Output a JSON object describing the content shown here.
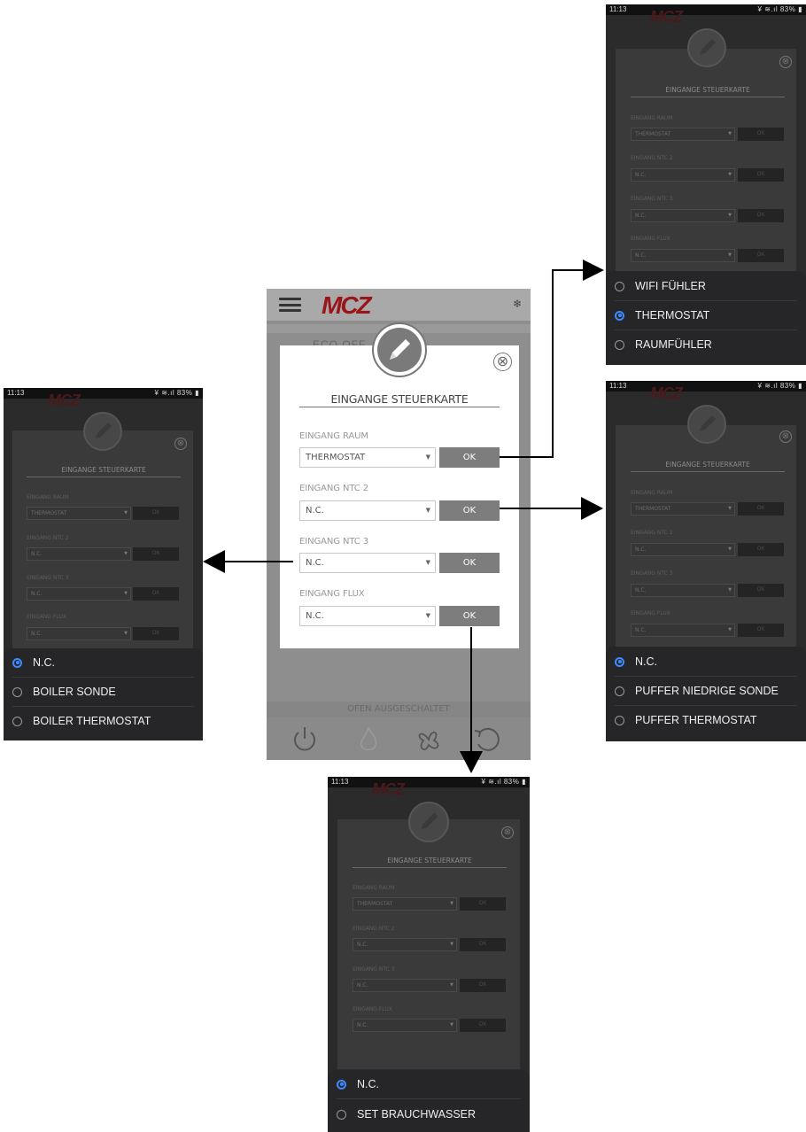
{
  "main": {
    "logo": "MCZ",
    "eco_text": "ECO OFF",
    "status_text": "OFEN AUSGESCHALTET",
    "dialog": {
      "title": "EINGANGE STEUERKARTE",
      "close_glyph": "⊗",
      "fields": [
        {
          "label": "EINGANG RAUM",
          "value": "THERMOSTAT",
          "ok": "OK"
        },
        {
          "label": "EINGANG NTC 2",
          "value": "N.C.",
          "ok": "OK"
        },
        {
          "label": "EINGANG NTC 3",
          "value": "N.C.",
          "ok": "OK"
        },
        {
          "label": "EINGANG FLUX",
          "value": "N.C.",
          "ok": "OK"
        }
      ]
    },
    "icons": [
      "power-icon",
      "flame-icon",
      "fan-icon",
      "refresh-icon"
    ]
  },
  "mini_status": {
    "time": "11:13",
    "right": "¥ ≋.ıl 83% ▮"
  },
  "mini_dialog": {
    "title": "EINGANGE STEUERKARTE",
    "labels": [
      "EINGANG RAUM",
      "EINGANG NTC 2",
      "EINGANG NTC 3",
      "EINGANG FLUX"
    ],
    "values": [
      "THERMOSTAT",
      "N.C.",
      "N.C.",
      "N.C."
    ],
    "ok": "OK"
  },
  "popups": {
    "raum": {
      "options": [
        {
          "label": "WIFI FÜHLER",
          "selected": false
        },
        {
          "label": "THERMOSTAT",
          "selected": true
        },
        {
          "label": "RAUMFÜHLER",
          "selected": false
        }
      ]
    },
    "ntc2": {
      "options": [
        {
          "label": "N.C.",
          "selected": true
        },
        {
          "label": "PUFFER NIEDRIGE SONDE",
          "selected": false
        },
        {
          "label": "PUFFER THERMOSTAT",
          "selected": false
        }
      ]
    },
    "ntc3": {
      "options": [
        {
          "label": "N.C.",
          "selected": true
        },
        {
          "label": "BOILER SONDE",
          "selected": false
        },
        {
          "label": "BOILER THERMOSTAT",
          "selected": false
        }
      ]
    },
    "flux": {
      "options": [
        {
          "label": "N.C.",
          "selected": true
        },
        {
          "label": "SET BRAUCHWASSER",
          "selected": false
        }
      ]
    }
  },
  "colors": {
    "brand_red": "#9a1518",
    "radio_selected": "#3d8bff",
    "ok_button": "#7d7d7d"
  }
}
